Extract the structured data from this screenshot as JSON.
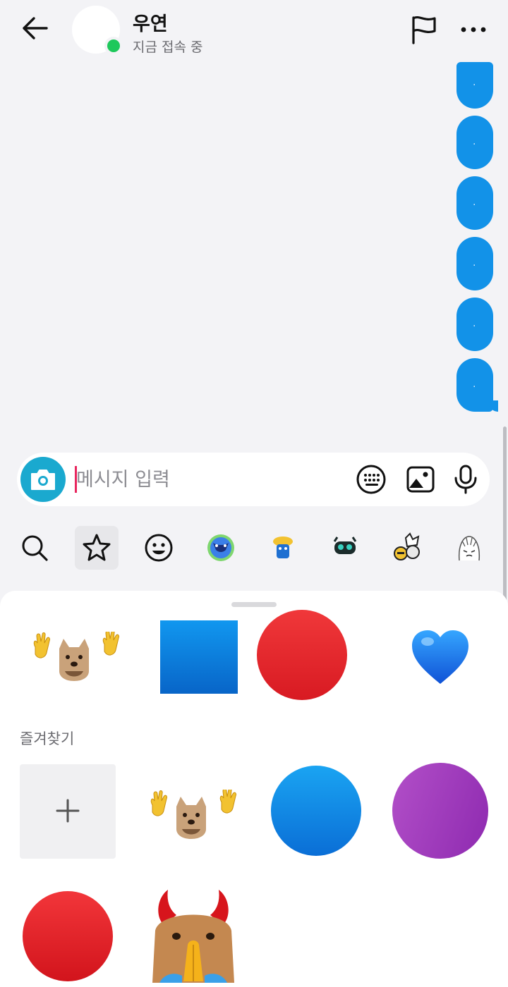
{
  "header": {
    "contact_name": "우연",
    "status": "지금 접속 중",
    "icons": {
      "back": "arrow-left-icon",
      "flag": "flag-icon",
      "more": "more-horizontal-icon"
    },
    "online_color": "#1ec85b"
  },
  "messages": {
    "bubbles": [
      ".",
      ".",
      ".",
      ".",
      ".",
      "."
    ],
    "bubble_color": "#1292e8"
  },
  "composer": {
    "placeholder": "메시지 입력",
    "value": "",
    "icons": [
      "camera-icon",
      "keyboard-icon",
      "gallery-icon",
      "microphone-icon"
    ],
    "camera_color": "#1aa9cf",
    "caret_color": "#e8265e"
  },
  "sticker_tabs": {
    "items": [
      "search-icon",
      "favorites-star-icon",
      "emoji-icon",
      "sticker-pack-1",
      "sticker-pack-2",
      "sticker-pack-3",
      "sticker-pack-4",
      "sticker-pack-5"
    ],
    "selected": "favorites-star-icon"
  },
  "sticker_panel": {
    "recent": [
      "dog-waving-sticker",
      "blue-square-sticker",
      "red-circle-sticker",
      "blue-heart-sticker"
    ],
    "favorites_title": "즐겨찾기",
    "favorites": [
      "add-favorite-button",
      "dog-waving-sticker",
      "blue-circle-sticker",
      "purple-circle-sticker",
      "red-circle-sticker",
      "devil-cat-sticker"
    ]
  }
}
